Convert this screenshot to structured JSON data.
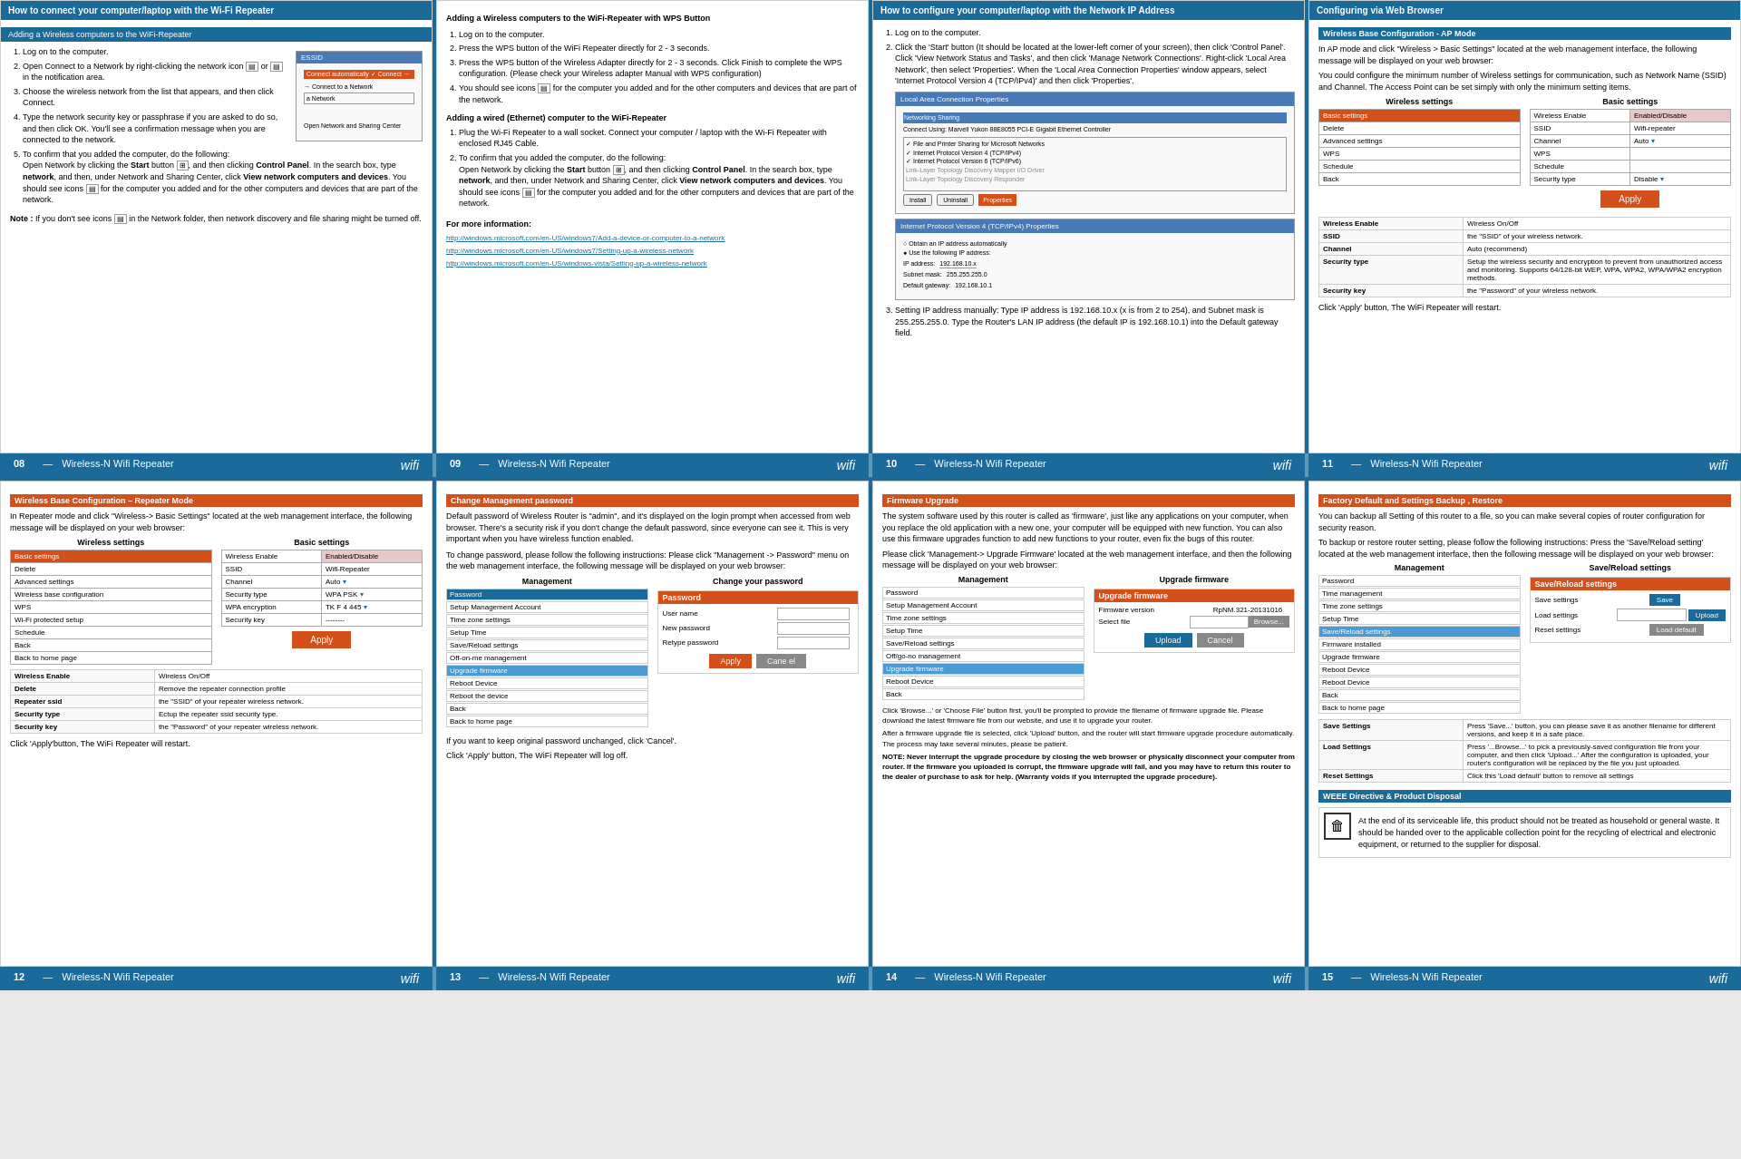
{
  "pages": {
    "p08": {
      "number": "08",
      "title": "Wireless-N Wifi Repeater"
    },
    "p09": {
      "number": "09",
      "title": "Wireless-N Wifi Repeater"
    },
    "p10": {
      "number": "10",
      "title": "Wireless-N Wifi Repeater"
    },
    "p11": {
      "number": "11",
      "title": "Wireless-N Wifi Repeater"
    },
    "p12": {
      "number": "12",
      "title": "Wireless-N Wifi Repeater"
    },
    "p13": {
      "number": "13",
      "title": "Wireless-N Wifi Repeater"
    },
    "p14": {
      "number": "14",
      "title": "Wireless-N Wifi Repeater"
    },
    "p15": {
      "number": "15",
      "title": "Wireless-N Wifi Repeater"
    }
  },
  "panel1": {
    "header": "How to connect your computer/laptop with the Wi-Fi Repeater",
    "subheader": "Adding a Wireless computers to the WiFi-Repeater",
    "steps": [
      "Log on to the computer.",
      "Open Connect to a Network by right-clicking the network icon or in the notification area.",
      "Choose the wireless network from the list that appears, and then click Connect.",
      "Type the network security key or passphrase if you are asked to do so, and then click OK. You'll see a confirmation message when you are connected to the network.",
      "To confirm that you added the computer, do the following: Open Network by clicking the Start button, and then clicking Control Panel. In the search box, type network, and then, under Network and Sharing Center, click View network computers and devices. You should see icons for the computer you added and for the other computers and devices that are part of the network."
    ],
    "note": "Note : If you don't see icons in the Network folder, then network discovery and file sharing might be turned off."
  },
  "panel2": {
    "wps_header": "Adding a Wireless computers to the WiFi-Repeater with WPS Button",
    "wps_steps": [
      "Log on to the computer.",
      "Press the WPS button of the WiFi Repeater directly for 2 - 3 seconds.",
      "Press the WPS button of the Wireless Adapter directly for 2 - 3 seconds. Click Finish to complete the WPS configuration. (Please check your Wireless adapter Manual with WPS configuration)",
      "You should see icons for the computer you added and for the other computers and devices that are part of the network."
    ],
    "ethernet_header": "Adding a wired (Ethernet) computer to the WiFi-Repeater",
    "ethernet_steps": [
      "Plug the Wi-Fi Repeater to a wall socket. Connect your computer / laptop with the Wi-Fi Repeater with enclosed RJ45 Cable.",
      "To confirm that you added the computer, do the following: Open Network by clicking the Start button, and then clicking Control Panel. In the search box, type network, and then, under Network and Sharing Center, click View network computers and devices. You should see icons for the computer you added and for the other computers and devices that are part of the network."
    ],
    "more_info": "For more information:",
    "urls": [
      "http://windows.microsoft.com/en-US/windows7/Add-a-device-or-computer-to-a-network",
      "http://windows.microsoft.com/en-US/windows7/Setting-up-a-wireless-network",
      "http://windows.microsoft.com/en-US/windows-vista/Setting-up-a-wireless-network"
    ]
  },
  "panel3": {
    "header": "How to configure your computer/laptop with the Network IP Address",
    "steps": [
      "Log on to the computer.",
      "Click the 'Start' button (It should be located at the lower-left corner of your screen), then click 'Control Panel'. Click 'View Network Status and Tasks', and then click 'Manage Network Connections'. Right-click 'Local Area Network', then select 'Properties'. When the 'Local Area Connection Properties' window appears, select 'Internet Protocol Version 4 (TCP/IPv4)' and then click 'Properties'.",
      "Setting IP address manually: Type IP address is 192.168.10.x (x is from 2 to 254), and Subnet mask is 255.255.255.0. Type the Router's LAN IP address (the default IP is 192.168.10.1) into the Default gateway field."
    ]
  },
  "panel4": {
    "header": "Configuring via Web Browser",
    "subheader": "Wireless Base Configuration - AP Mode",
    "intro": "In AP mode and click \"Wireless > Basic Settings\" located at the web management interface, the following message will be displayed on your web browser:",
    "min_config": "You could configure the minimum number of Wireless settings for communication, such as Network Name (SSID) and Channel. The Access Point can be set simply with only the minimum setting items.",
    "wireless_settings_label": "Wireless settings",
    "basic_settings_label": "Basic settings",
    "table_rows": [
      {
        "label": "Basic settings",
        "value": ""
      },
      {
        "label": "Delete",
        "value": ""
      },
      {
        "label": "Advanced settings",
        "value": ""
      },
      {
        "label": "WPS",
        "value": ""
      },
      {
        "label": "Schedule",
        "value": ""
      },
      {
        "label": "Back",
        "value": ""
      }
    ],
    "basic_rows": [
      {
        "label": "Wireless Enable",
        "value": "Enabled/Disable"
      },
      {
        "label": "SSID",
        "value": "Wifi-repeater"
      },
      {
        "label": "Channel",
        "value": "Auto"
      },
      {
        "label": "WPS",
        "value": ""
      },
      {
        "label": "Schedule",
        "value": ""
      },
      {
        "label": "Security type",
        "value": "Disable"
      }
    ],
    "apply_btn": "Apply",
    "info_rows": [
      {
        "label": "Wireless Enable",
        "value": "Wireless On/Off"
      },
      {
        "label": "SSID",
        "value": "the \"SSID\" of your wireless network."
      },
      {
        "label": "Channel",
        "value": "Auto (recommend)"
      },
      {
        "label": "Security type",
        "value": "Setup the wireless security and encryption to prevent from unauthorized access and monitoring. Supports 64/128-bit WEP, WPA, WPA2, WPA/WPA2 encryption methods."
      },
      {
        "label": "Security key",
        "value": "the \"Password\" of your wireless network."
      }
    ],
    "click_apply": "Click 'Apply' button, The WiFi Repeater will restart."
  },
  "panel_b1": {
    "header": "Wireless Base Configuration – Repeater Mode",
    "intro": "In Repeater mode and click \"Wireless-> Basic Settings\" located at the web management interface, the following message will be displayed on your web browser:",
    "wireless_settings_label": "Wireless settings",
    "basic_settings_label": "Basic settings",
    "table_rows": [
      {
        "label": "Basic settings",
        "selected": true
      },
      {
        "label": "Delete",
        "selected": false
      },
      {
        "label": "Advanced settings",
        "selected": false
      },
      {
        "label": "Wireless base configuration",
        "selected": false
      },
      {
        "label": "WPS",
        "selected": false
      },
      {
        "label": "Wi-Fi protected setup",
        "selected": false
      },
      {
        "label": "Schedule",
        "selected": false
      },
      {
        "label": "Back",
        "selected": false
      },
      {
        "label": "Back to home page",
        "selected": false
      }
    ],
    "basic_rows": [
      {
        "label": "Wireless Enable",
        "value": "Enabled/Disable"
      },
      {
        "label": "SSID",
        "value": "Wifi-Repeater"
      },
      {
        "label": "Channel",
        "value": "Auto"
      },
      {
        "label": "Security type",
        "value": "WPA PSK"
      },
      {
        "label": "WPA encryption",
        "value": "TK F 4 445"
      },
      {
        "label": "Security key",
        "value": "--------"
      }
    ],
    "apply_btn": "Apply",
    "info_rows": [
      {
        "label": "Wireless Enable",
        "value": "Wireless On/Off"
      },
      {
        "label": "Delete",
        "value": "Remove the repeater connection profile"
      },
      {
        "label": "Repeater ssid",
        "value": "the \"SSID\" of your repeater wireless network."
      },
      {
        "label": "Security type",
        "value": "Ectup the repeater ssid security type."
      },
      {
        "label": "Security key",
        "value": "the \"Password\" of your repeater wireless network."
      }
    ],
    "click_apply": "Click 'Apply'button, The WiFi Repeater will restart."
  },
  "panel_b2": {
    "header": "Change Management password",
    "intro": "Default password of Wireless Router is \"admin\", and it's displayed on the login prompt when accessed from web browser. There's a security risk if you don't change the default password, since everyone can see it. This is very important when you have wireless function enabled.",
    "instructions": "To change password, please follow the following instructions: Please click \"Management -> Password\" menu on the web management interface, the following message will be displayed on your web browser:",
    "mgmt_label": "Management",
    "form_label": "Change your password",
    "form_rows": [
      {
        "label": "Password",
        "value": ""
      },
      {
        "label": "User name",
        "value": ""
      },
      {
        "label": "New password",
        "value": ""
      },
      {
        "label": "Retype password",
        "value": ""
      }
    ],
    "mgmt_items": [
      {
        "label": "Password",
        "selected": true
      },
      {
        "label": "Setup Management Account",
        "selected": false
      },
      {
        "label": "Time zone settings",
        "selected": false
      },
      {
        "label": "Setup Time",
        "selected": false
      },
      {
        "label": "Save/Reload settings",
        "selected": false
      },
      {
        "label": "Off-on-me management",
        "selected": false
      },
      {
        "label": "Upgrade firmware",
        "selected": false
      },
      {
        "label": "Upgrade firmware",
        "highlight": true
      },
      {
        "label": "Reboot Device",
        "selected": false
      },
      {
        "label": "Reboot the device",
        "selected": false
      },
      {
        "label": "Back",
        "selected": false
      },
      {
        "label": "Back to home page",
        "selected": false
      }
    ],
    "apply_btn": "Apply",
    "cancel_btn": "Cane el",
    "keep_original": "If you want to keep original password unchanged, click 'Cancel'.",
    "click_apply": "Click 'Apply' button, The WiFi Repeater will log off."
  },
  "panel_b3": {
    "header": "Firmware Upgrade",
    "intro": "The system software used by this router is called as 'firmware', just like any applications on your computer, when you replace the old application with a new one, your computer will be equipped with new function. You can also use this firmware upgrades function to add new functions to your router, even fix the bugs of this router.",
    "instructions": "Please click 'Management-> Upgrade Firmware' located at the web management interface, and then the following message will be displayed on your web browser:",
    "mgmt_label": "Management",
    "form_label": "Upgrade firmware",
    "form_rows": [
      {
        "label": "Password",
        "value": ""
      },
      {
        "label": "Setup Management Account",
        "value": ""
      },
      {
        "label": "Time zone settings",
        "value": ""
      },
      {
        "label": "Setup Time",
        "value": ""
      },
      {
        "label": "Save/Reload settings",
        "value": ""
      },
      {
        "label": "Off/go-no management",
        "value": ""
      },
      {
        "label": "Upgrade firmware",
        "value": ""
      },
      {
        "label": "Reboot Device",
        "value": ""
      },
      {
        "label": "Back",
        "value": ""
      }
    ],
    "firmware_rows": [
      {
        "label": "Firmware version",
        "value": "RpNM.321-20131016"
      },
      {
        "label": "Select file",
        "value": ""
      }
    ],
    "upload_btn": "Upload",
    "cancel_btn": "Cancel",
    "browse_btn": "Browse...",
    "notes": [
      "Click 'Browse...' or 'Choose File' button first, you'll be prompted to provide the filename of firmware upgrade file. Please download the latest firmware file from our website, and use it to upgrade your router.",
      "After a firmware upgrade file is selected, click 'Upload' button, and the router will start firmware upgrade procedure automatically. The process may take several minutes, please be patient.",
      "NOTE: Never interrupt the upgrade procedure by closing the web browser or physically disconnect your computer from router. If the firmware you uploaded is corrupt, the firmware upgrade will fail, and you may have to return this router to the dealer of purchase to ask for help. (Warranty voids if you interrupted the upgrade procedure)."
    ]
  },
  "panel_b4": {
    "header": "Factory Default and Settings Backup , Restore",
    "intro": "You can backup all Setting of this router to a file, so you can make several copies of router configuration for security reason.",
    "instructions": "To backup or restore router setting, please follow the following instructions: Press the 'Save/Reload setting' located at the web management interface, then the following message will be displayed on your web browser:",
    "mgmt_label": "Management",
    "form_label": "Save/Reload settings",
    "mgmt_items": [
      {
        "label": "Password",
        "value": ""
      },
      {
        "label": "Time management",
        "value": ""
      },
      {
        "label": "Time zone settings",
        "value": ""
      },
      {
        "label": "Setup Time",
        "value": ""
      },
      {
        "label": "Save/Reload settings",
        "highlight": true
      },
      {
        "label": "Firmware installed",
        "value": ""
      },
      {
        "label": "Upgrade firmware",
        "value": ""
      },
      {
        "label": "Reboot Device",
        "value": ""
      },
      {
        "label": "Reboot Device",
        "value": ""
      },
      {
        "label": "Back",
        "value": ""
      },
      {
        "label": "Back to home page",
        "value": ""
      }
    ],
    "save_rows": [
      {
        "label": "Save settings",
        "value": ""
      },
      {
        "label": "Load settings",
        "value": ""
      },
      {
        "label": "Reset settings",
        "value": ""
      }
    ],
    "save_btn": "Save",
    "upload_btn": "Upload",
    "load_default_btn": "Load default",
    "info_rows": [
      {
        "label": "Save Settings",
        "value": "Press 'Save...' button, you can please save it as another filename for different versions, and keep it in a safe place."
      },
      {
        "label": "Load Settings",
        "value": "Press '...Browse...' to pick a previously-saved configuration file from your computer, and then click 'Upload...' After the configuration is uploaded, your router's configuration will be replaced by the file you just uploaded."
      },
      {
        "label": "Reset Settings",
        "value": "Click this 'Load default' button to remove all settings"
      }
    ],
    "weee_header": "WEEE Directive & Product Disposal",
    "weee_text": "At the end of its serviceable life, this product should not be treated as household or general waste. It should be handed over to the applicable collection point for the recycling of electrical and electronic equipment, or returned to the supplier for disposal."
  }
}
